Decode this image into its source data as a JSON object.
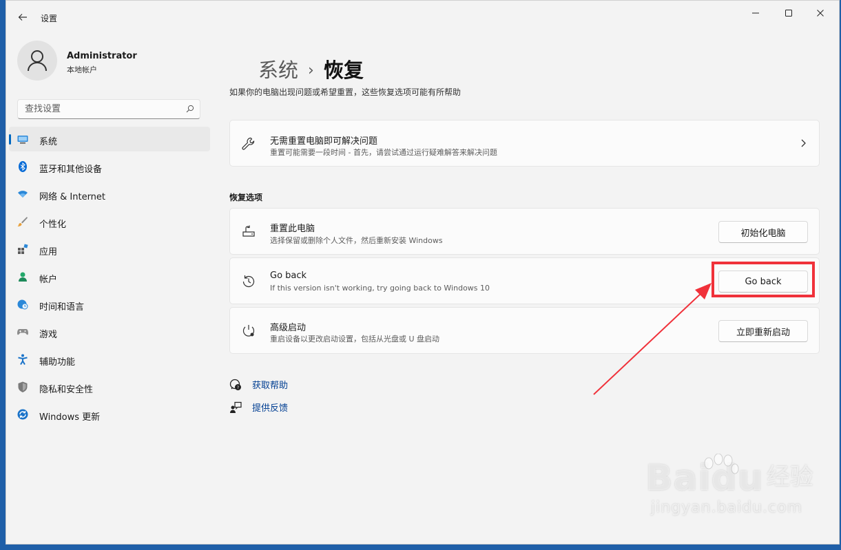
{
  "window": {
    "title": "设置",
    "controls": {
      "minimize": "—",
      "maximize": "☐",
      "close": "✕"
    }
  },
  "user": {
    "name": "Administrator",
    "account_type": "本地帐户"
  },
  "search": {
    "placeholder": "查找设置",
    "value": ""
  },
  "sidebar": {
    "items": [
      {
        "label": "系统",
        "icon": "system-display-icon",
        "selected": true
      },
      {
        "label": "蓝牙和其他设备",
        "icon": "bluetooth-icon"
      },
      {
        "label": "网络 & Internet",
        "icon": "wifi-icon"
      },
      {
        "label": "个性化",
        "icon": "paintbrush-icon"
      },
      {
        "label": "应用",
        "icon": "apps-icon"
      },
      {
        "label": "帐户",
        "icon": "account-icon"
      },
      {
        "label": "时间和语言",
        "icon": "globe-clock-icon"
      },
      {
        "label": "游戏",
        "icon": "gamepad-icon"
      },
      {
        "label": "辅助功能",
        "icon": "accessibility-icon"
      },
      {
        "label": "隐私和安全性",
        "icon": "shield-icon"
      },
      {
        "label": "Windows 更新",
        "icon": "windows-update-icon"
      }
    ]
  },
  "header": {
    "breadcrumb_parent": "系统",
    "breadcrumb_separator": "›",
    "breadcrumb_current": "恢复",
    "description": "如果你的电脑出现问题或希望重置，这些恢复选项可能有所帮助"
  },
  "troubleshoot_card": {
    "title": "无需重置电脑即可解决问题",
    "description": "重置可能需要一段时间 - 首先，请尝试通过运行疑难解答来解决问题"
  },
  "recovery_section": {
    "title": "恢复选项",
    "options": [
      {
        "title": "重置此电脑",
        "description": "选择保留或删除个人文件，然后重新安装 Windows",
        "button": "初始化电脑"
      },
      {
        "title": "Go back",
        "description": "If this version isn't working, try going back to Windows 10",
        "button": "Go back"
      },
      {
        "title": "高级启动",
        "description": "重启设备以更改启动设置，包括从光盘或 U 盘启动",
        "button": "立即重新启动"
      }
    ]
  },
  "links": {
    "help": "获取帮助",
    "feedback": "提供反馈"
  },
  "watermark": {
    "brand": "Bai",
    "brand2": "du",
    "cn": "经验",
    "url": "jingyan.baidu.com"
  },
  "colors": {
    "accent": "#0067c0",
    "annotation": "#f0313a",
    "link": "#003e92"
  }
}
